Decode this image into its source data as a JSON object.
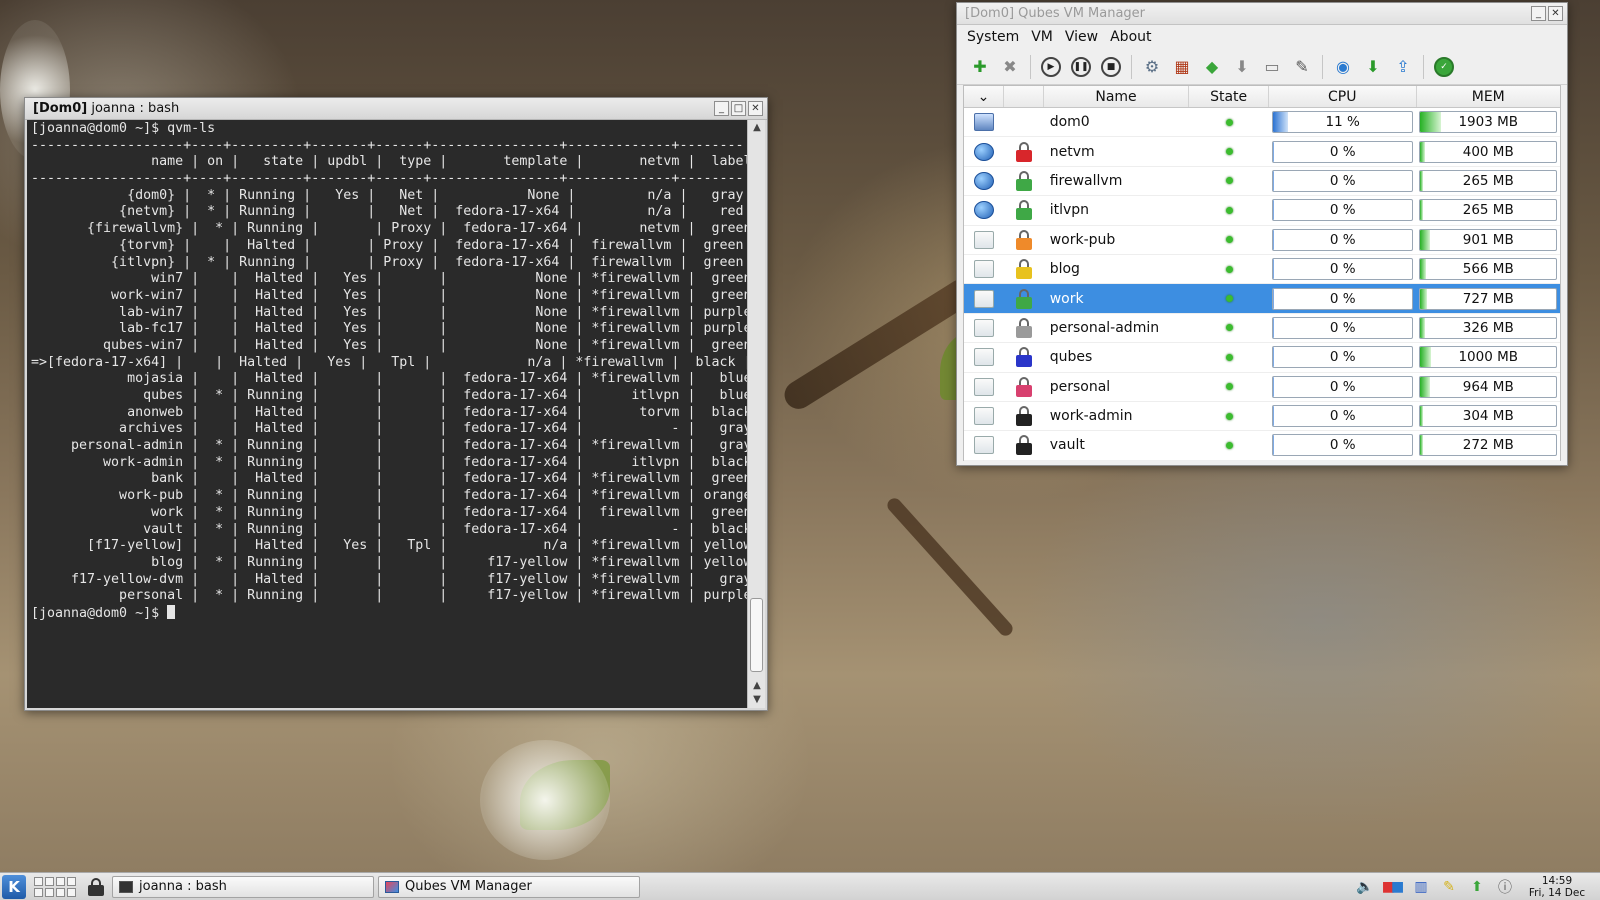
{
  "terminal": {
    "title_prefix": "[Dom0]",
    "title_rest": " joanna : bash",
    "lines": [
      "[joanna@dom0 ~]$ qvm-ls",
      "-------------------+----+---------+-------+------+----------------+-------------+--------",
      "               name | on |   state | updbl |  type |       template |       netvm |  label |",
      "-------------------+----+---------+-------+------+----------------+-------------+--------",
      "            {dom0} |  * | Running |   Yes |   Net |           None |         n/a |   gray |",
      "           {netvm} |  * | Running |       |   Net |  fedora-17-x64 |         n/a |    red |",
      "       {firewallvm} |  * | Running |       | Proxy |  fedora-17-x64 |       netvm |  green |",
      "           {torvm} |    |  Halted |       | Proxy |  fedora-17-x64 |  firewallvm |  green |",
      "          {itlvpn} |  * | Running |       | Proxy |  fedora-17-x64 |  firewallvm |  green |",
      "               win7 |    |  Halted |   Yes |       |           None | *firewallvm |  green |",
      "          work-win7 |    |  Halted |   Yes |       |           None | *firewallvm |  green |",
      "           lab-win7 |    |  Halted |   Yes |       |           None | *firewallvm | purple |",
      "           lab-fc17 |    |  Halted |   Yes |       |           None | *firewallvm | purple |",
      "         qubes-win7 |    |  Halted |   Yes |       |           None | *firewallvm |  green |",
      "=>[fedora-17-x64] |    |  Halted |   Yes |   Tpl |            n/a | *firewallvm |  black |",
      "            mojasia |    |  Halted |       |       |  fedora-17-x64 | *firewallvm |   blue |",
      "              qubes |  * | Running |       |       |  fedora-17-x64 |      itlvpn |   blue |",
      "            anonweb |    |  Halted |       |       |  fedora-17-x64 |       torvm |  black |",
      "           archives |    |  Halted |       |       |  fedora-17-x64 |           - |   gray |",
      "     personal-admin |  * | Running |       |       |  fedora-17-x64 | *firewallvm |   gray |",
      "         work-admin |  * | Running |       |       |  fedora-17-x64 |      itlvpn |  black |",
      "               bank |    |  Halted |       |       |  fedora-17-x64 | *firewallvm |  green |",
      "           work-pub |  * | Running |       |       |  fedora-17-x64 | *firewallvm | orange |",
      "               work |  * | Running |       |       |  fedora-17-x64 |  firewallvm |  green |",
      "              vault |  * | Running |       |       |  fedora-17-x64 |           - |  black |",
      "       [f17-yellow] |    |  Halted |   Yes |   Tpl |            n/a | *firewallvm | yellow |",
      "               blog |  * | Running |       |       |     f17-yellow | *firewallvm | yellow |",
      "     f17-yellow-dvm |    |  Halted |       |       |     f17-yellow | *firewallvm |   gray |",
      "           personal |  * | Running |       |       |     f17-yellow | *firewallvm | purple |"
    ],
    "prompt": "[joanna@dom0 ~]$ "
  },
  "manager": {
    "title": "[Dom0] Qubes VM Manager",
    "menu": [
      "System",
      "VM",
      "View",
      "About"
    ],
    "columns": [
      "Name",
      "State",
      "CPU",
      "MEM"
    ],
    "vms": [
      {
        "name": "dom0",
        "icon": "dom0-icon",
        "lock": "",
        "cpu": "11 %",
        "cpu_pct": 11,
        "mem": "1903 MB",
        "mem_pct": 15
      },
      {
        "name": "netvm",
        "icon": "net",
        "lock": "#d8262b",
        "cpu": "0 %",
        "cpu_pct": 0,
        "mem": "400 MB",
        "mem_pct": 3
      },
      {
        "name": "firewallvm",
        "icon": "net",
        "lock": "#3fa846",
        "cpu": "0 %",
        "cpu_pct": 0,
        "mem": "265 MB",
        "mem_pct": 2
      },
      {
        "name": "itlvpn",
        "icon": "net",
        "lock": "#3fa846",
        "cpu": "0 %",
        "cpu_pct": 0,
        "mem": "265 MB",
        "mem_pct": 2
      },
      {
        "name": "work-pub",
        "icon": "app",
        "lock": "#ef8a2a",
        "cpu": "0 %",
        "cpu_pct": 0,
        "mem": "901 MB",
        "mem_pct": 7
      },
      {
        "name": "blog",
        "icon": "app",
        "lock": "#e8c21e",
        "cpu": "0 %",
        "cpu_pct": 0,
        "mem": "566 MB",
        "mem_pct": 4
      },
      {
        "name": "work",
        "icon": "app",
        "lock": "#3fa846",
        "cpu": "0 %",
        "cpu_pct": 0,
        "mem": "727 MB",
        "mem_pct": 5,
        "selected": true
      },
      {
        "name": "personal-admin",
        "icon": "app",
        "lock": "#9a9a9a",
        "cpu": "0 %",
        "cpu_pct": 0,
        "mem": "326 MB",
        "mem_pct": 3
      },
      {
        "name": "qubes",
        "icon": "app",
        "lock": "#2a35c9",
        "cpu": "0 %",
        "cpu_pct": 0,
        "mem": "1000 MB",
        "mem_pct": 8
      },
      {
        "name": "personal",
        "icon": "app",
        "lock": "#d8406f",
        "cpu": "0 %",
        "cpu_pct": 0,
        "mem": "964 MB",
        "mem_pct": 7
      },
      {
        "name": "work-admin",
        "icon": "app",
        "lock": "#222222",
        "cpu": "0 %",
        "cpu_pct": 0,
        "mem": "304 MB",
        "mem_pct": 2
      },
      {
        "name": "vault",
        "icon": "app",
        "lock": "#222222",
        "cpu": "0 %",
        "cpu_pct": 0,
        "mem": "272 MB",
        "mem_pct": 2
      }
    ]
  },
  "taskbar": {
    "tasks": [
      "joanna : bash",
      "Qubes VM Manager"
    ],
    "clock_time": "14:59",
    "clock_date": "Fri, 14 Dec"
  }
}
